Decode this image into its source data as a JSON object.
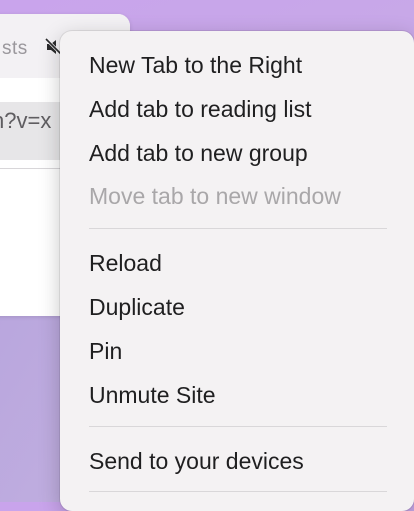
{
  "background_tab": {
    "title_fragment": "sts",
    "url_fragment": "h?v=x"
  },
  "context_menu": {
    "items": [
      {
        "label": "New Tab to the Right",
        "enabled": true
      },
      {
        "label": "Add tab to reading list",
        "enabled": true
      },
      {
        "label": "Add tab to new group",
        "enabled": true
      },
      {
        "label": "Move tab to new window",
        "enabled": false
      },
      {
        "label": "Reload",
        "enabled": true
      },
      {
        "label": "Duplicate",
        "enabled": true
      },
      {
        "label": "Pin",
        "enabled": true
      },
      {
        "label": "Unmute Site",
        "enabled": true
      },
      {
        "label": "Send to your devices",
        "enabled": true
      }
    ]
  },
  "icons": {
    "tab_audio": "speaker-muted-icon"
  },
  "colors": {
    "menu_background": "#f4f2f3",
    "menu_text": "#1f1f20",
    "menu_text_disabled": "#a9a7a9",
    "desktop_wallpaper": "#c9a4ec"
  }
}
